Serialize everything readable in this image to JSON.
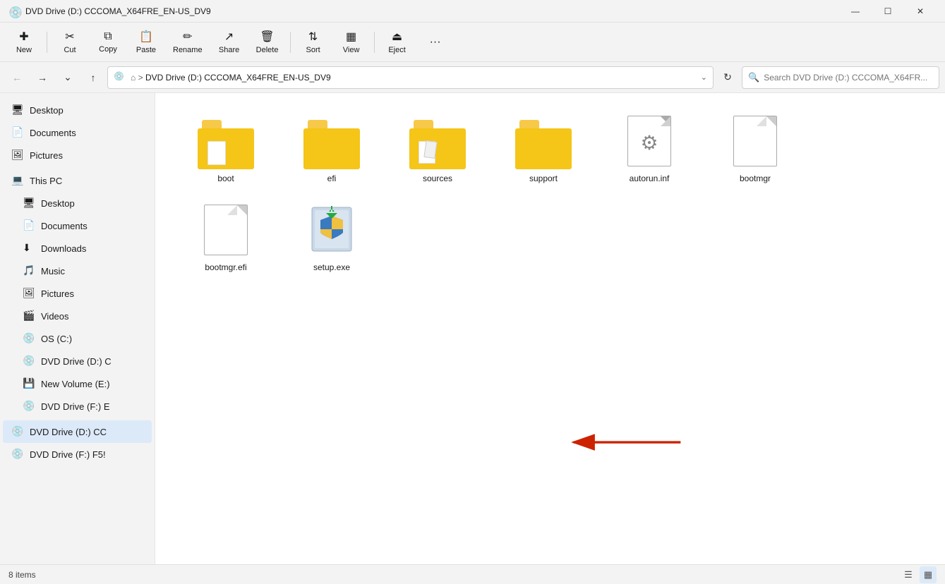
{
  "titleBar": {
    "icon": "💿",
    "title": "DVD Drive (D:) CCCOMA_X64FRE_EN-US_DV9",
    "minimizeLabel": "—",
    "maximizeLabel": "☐",
    "closeLabel": "✕"
  },
  "toolbar": {
    "newLabel": "New",
    "cutLabel": "Cut",
    "copyLabel": "Copy",
    "pasteLabel": "Paste",
    "renameLabel": "Rename",
    "shareLabel": "Share",
    "deleteLabel": "Delete",
    "sortLabel": "Sort",
    "viewLabel": "View",
    "ejectLabel": "Eject",
    "moreLabel": "···"
  },
  "addressBar": {
    "breadcrumb": "DVD Drive (D:) CCCOMA_X64FRE_EN-US_DV9",
    "searchPlaceholder": "Search DVD Drive (D:) CCCOMA_X64FR..."
  },
  "sidebar": {
    "quickAccess": [
      {
        "id": "desktop-qa",
        "label": "Desktop",
        "icon": "🖥"
      },
      {
        "id": "documents-qa",
        "label": "Documents",
        "icon": "📄"
      },
      {
        "id": "pictures-qa",
        "label": "Pictures",
        "icon": "🖼"
      }
    ],
    "thisPC": {
      "label": "This PC",
      "icon": "💻",
      "items": [
        {
          "id": "desktop-pc",
          "label": "Desktop",
          "icon": "🖥"
        },
        {
          "id": "documents-pc",
          "label": "Documents",
          "icon": "📄"
        },
        {
          "id": "downloads-pc",
          "label": "Downloads",
          "icon": "⬇"
        },
        {
          "id": "music-pc",
          "label": "Music",
          "icon": "🎵"
        },
        {
          "id": "pictures-pc",
          "label": "Pictures",
          "icon": "🖼"
        },
        {
          "id": "videos-pc",
          "label": "Videos",
          "icon": "🎬"
        },
        {
          "id": "os-c",
          "label": "OS (C:)",
          "icon": "💿"
        },
        {
          "id": "dvd-d",
          "label": "DVD Drive (D:) C",
          "icon": "💿"
        },
        {
          "id": "volume-e",
          "label": "New Volume (E:)",
          "icon": "💾"
        },
        {
          "id": "dvd-f",
          "label": "DVD Drive (F:) E",
          "icon": "💿"
        }
      ]
    },
    "activeItem": "dvd-d-active",
    "bottomItems": [
      {
        "id": "dvd-d-active",
        "label": "DVD Drive (D:) CC",
        "icon": "💿"
      },
      {
        "id": "dvd-f-bottom",
        "label": "DVD Drive (F:) F5!",
        "icon": "💿"
      }
    ]
  },
  "content": {
    "items": [
      {
        "id": "boot",
        "name": "boot",
        "type": "folder",
        "hasPaper": false
      },
      {
        "id": "efi",
        "name": "efi",
        "type": "folder",
        "hasPaper": false
      },
      {
        "id": "sources",
        "name": "sources",
        "type": "folder",
        "hasPaper": true
      },
      {
        "id": "support",
        "name": "support",
        "type": "folder",
        "hasPaper": false
      },
      {
        "id": "autorun",
        "name": "autorun.inf",
        "type": "inf"
      },
      {
        "id": "bootmgr",
        "name": "bootmgr",
        "type": "generic"
      },
      {
        "id": "bootmgrefi",
        "name": "bootmgr.efi",
        "type": "generic-small"
      },
      {
        "id": "setup",
        "name": "setup.exe",
        "type": "setup"
      }
    ]
  },
  "statusBar": {
    "itemCount": "8 items"
  }
}
